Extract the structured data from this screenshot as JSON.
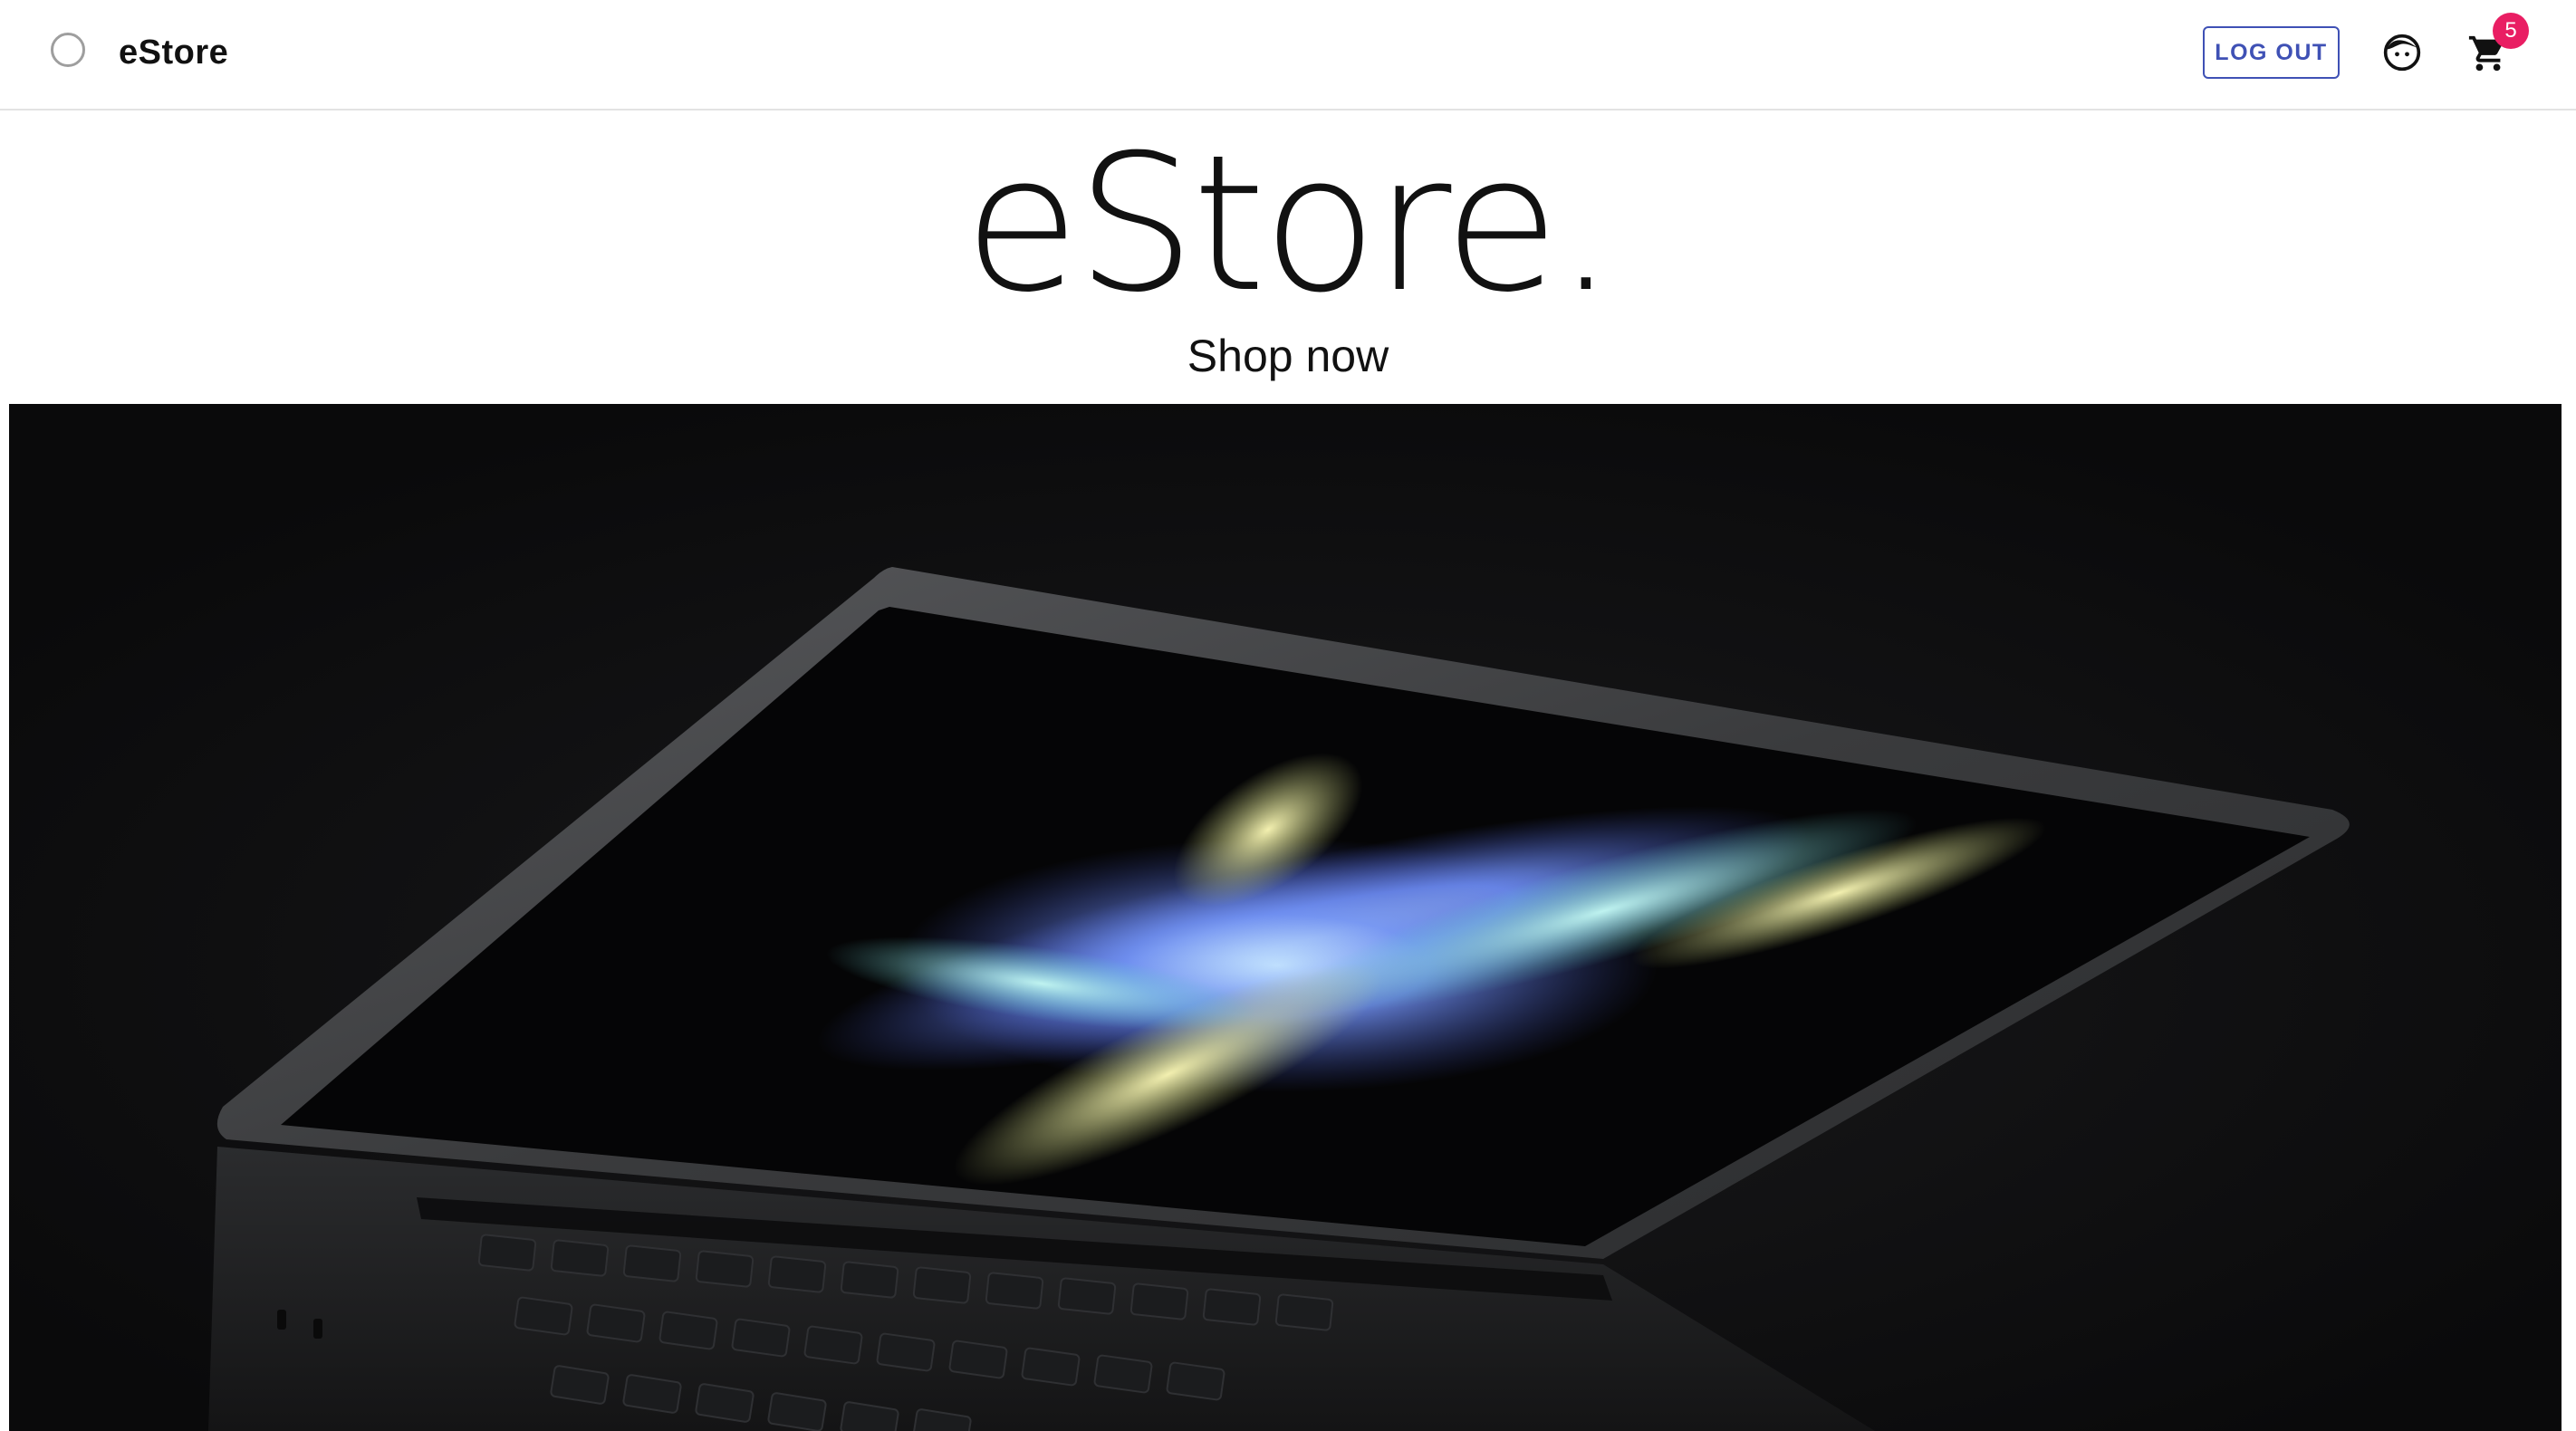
{
  "header": {
    "brand": "eStore",
    "logout_label": "LOG OUT",
    "logo_icon": "circle-logo-icon",
    "account_icon": "face-icon",
    "cart_icon": "shopping-cart-icon",
    "cart_count": "5"
  },
  "hero": {
    "title": "eStore.",
    "subtitle": "Shop now",
    "image_icon": "laptop-image"
  },
  "colors": {
    "accent": "#3f51b5",
    "badge": "#e91e63",
    "hero_background": "#0c0c0d"
  }
}
